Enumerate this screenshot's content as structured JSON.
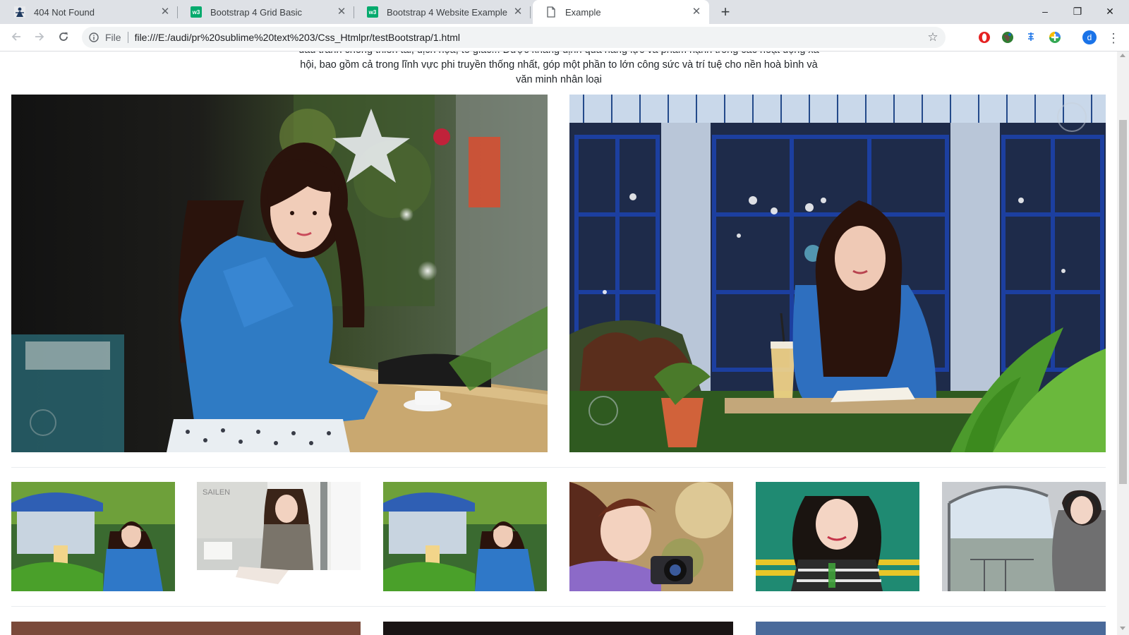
{
  "browser": {
    "tabs": [
      {
        "title": "404 Not Found",
        "favicon": "user-icon",
        "active": false
      },
      {
        "title": "Bootstrap 4 Grid Basic",
        "favicon": "w3schools-icon",
        "active": false
      },
      {
        "title": "Bootstrap 4 Website Example",
        "favicon": "w3schools-icon",
        "active": false
      },
      {
        "title": "Example",
        "favicon": "page-icon",
        "active": true
      }
    ],
    "w3_badge": "w3",
    "new_tab_glyph": "+",
    "window_controls": {
      "minimize": "–",
      "restore": "❐",
      "close": "✕"
    },
    "address": {
      "scheme_label": "File",
      "url": "file:///E:/audi/pr%20sublime%20text%203/Css_Htmlpr/testBootstrap/1.html"
    },
    "profile_initial": "d",
    "extensions": [
      "opera-icon",
      "globe-icon",
      "translate-icon",
      "plus-icon"
    ]
  },
  "page": {
    "intro_lines": [
      "đấu tranh chống thiên tai, địch họa, tố giác... Được khẳng định qua năng lực và phẩm hạnh trong các hoạt động xã",
      "hội, bao gồm cả trong lĩnh vực phi truyền thống nhất, góp một phần to lớn công sức và trí tuệ cho nền hoà bình và",
      "văn minh nhân loại"
    ],
    "featured_photos": [
      {
        "name": "girl-cafe-table-photo",
        "scene": "cafe-table"
      },
      {
        "name": "girl-reading-window-photo",
        "scene": "reading-window"
      }
    ],
    "thumbnails": [
      {
        "name": "thumb-blue-umbrella-photo"
      },
      {
        "name": "thumb-kitchen-sweater-photo"
      },
      {
        "name": "thumb-blue-umbrella-2-photo"
      },
      {
        "name": "thumb-camera-girl-photo"
      },
      {
        "name": "thumb-green-wall-photo"
      },
      {
        "name": "thumb-helicopter-photo"
      }
    ]
  }
}
